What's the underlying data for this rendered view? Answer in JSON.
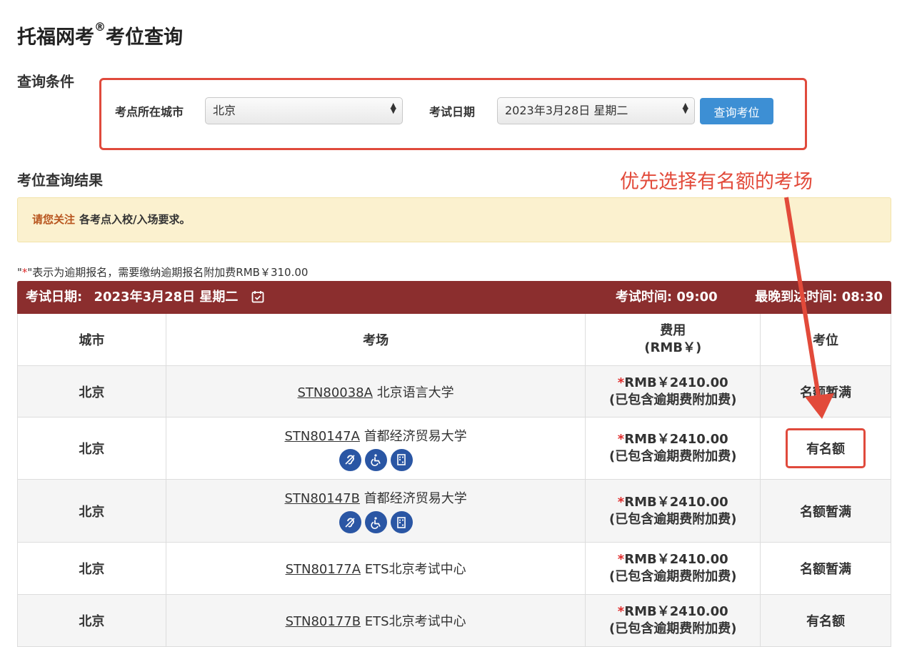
{
  "page": {
    "title": "托福网考",
    "title_mark": "®",
    "title_suffix": "考位查询"
  },
  "query": {
    "heading": "查询条件",
    "city_label": "考点所在城市",
    "city_value": "北京",
    "date_label": "考试日期",
    "date_value": "2023年3月28日 星期二",
    "submit_label": "查询考位"
  },
  "results": {
    "heading": "考位查询结果",
    "notice_strong": "请您关注",
    "notice_text": "各考点入校/入场要求。",
    "late_note_prefix": "\"",
    "late_note_star": "*",
    "late_note_suffix": "\"表示为逾期报名，需要缴纳逾期报名附加费RMB￥310.00",
    "exam_date_label": "考试日期:",
    "exam_date_value": "2023年3月28日 星期二",
    "exam_time_label": "考试时间:",
    "exam_time_value": "09:00",
    "arrival_label": "最晚到达时间:",
    "arrival_value": "08:30",
    "columns": {
      "city": "城市",
      "center": "考场",
      "fee_line1": "费用",
      "fee_line2": "(RMB￥)",
      "seat": "考位"
    },
    "rows": [
      {
        "city": "北京",
        "code": "STN80038A",
        "name": "北京语言大学",
        "fee_star": "*",
        "fee": "RMB￥2410.00",
        "fee_note": "(已包含逾期费附加费)",
        "seat": "名额暂满",
        "icons": []
      },
      {
        "city": "北京",
        "code": "STN80147A",
        "name": "首都经济贸易大学",
        "fee_star": "*",
        "fee": "RMB￥2410.00",
        "fee_note": "(已包含逾期费附加费)",
        "seat": "有名额",
        "icons": [
          "hearing-icon",
          "wheelchair-icon",
          "braille-icon"
        ]
      },
      {
        "city": "北京",
        "code": "STN80147B",
        "name": "首都经济贸易大学",
        "fee_star": "*",
        "fee": "RMB￥2410.00",
        "fee_note": "(已包含逾期费附加费)",
        "seat": "名额暂满",
        "icons": [
          "hearing-icon",
          "wheelchair-icon",
          "braille-icon"
        ]
      },
      {
        "city": "北京",
        "code": "STN80177A",
        "name": "ETS北京考试中心",
        "fee_star": "*",
        "fee": "RMB￥2410.00",
        "fee_note": "(已包含逾期费附加费)",
        "seat": "名额暂满",
        "icons": []
      },
      {
        "city": "北京",
        "code": "STN80177B",
        "name": "ETS北京考试中心",
        "fee_star": "*",
        "fee": "RMB￥2410.00",
        "fee_note": "(已包含逾期费附加费)",
        "seat": "有名额",
        "icons": []
      }
    ]
  },
  "annotation": {
    "text": "优先选择有名额的考场",
    "color": "#e24a3a"
  },
  "colors": {
    "header_bar": "#8b2e2e",
    "button": "#3d8fd4",
    "notice_bg": "#fbf1cf",
    "highlight": "#e04a3c",
    "icon_bg": "#2a56a4"
  }
}
